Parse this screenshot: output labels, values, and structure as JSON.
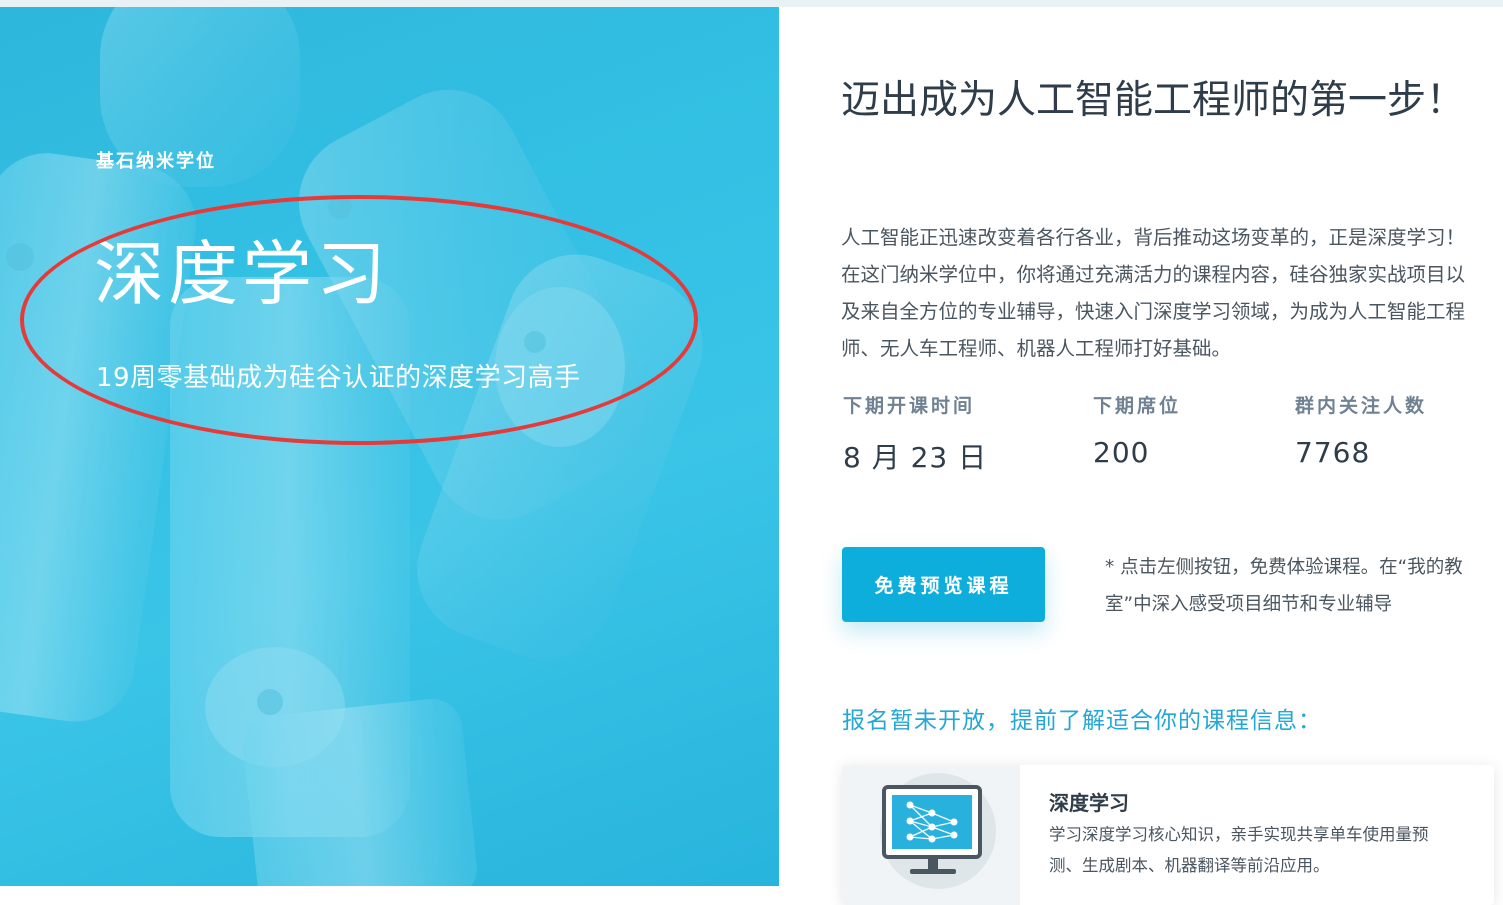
{
  "hero": {
    "eyebrow": "基石纳米学位",
    "title": "深度学习",
    "subtitle": "19周零基础成为硅谷认证的深度学习高手"
  },
  "colors": {
    "hero_bg": "#35c3e6",
    "accent": "#0eaedc",
    "annotation": "#e53a3a",
    "heading_text": "#2e3d49",
    "link_text": "#25a7d6"
  },
  "panel": {
    "headline": "迈出成为人工智能工程师的第一步！",
    "description": "人工智能正迅速改变着各行各业，背后推动这场变革的，正是深度学习！在这门纳米学位中，你将通过充满活力的课程内容，硅谷独家实战项目以及来自全方位的专业辅导，快速入门深度学习领域，为成为人工智能工程师、无人车工程师、机器人工程师打好基础。",
    "stats": [
      {
        "label": "下期开课时间",
        "value": "8 月 23 日"
      },
      {
        "label": "下期席位",
        "value": "200"
      },
      {
        "label": "群内关注人数",
        "value": "7768"
      }
    ],
    "cta_label": "免费预览课程",
    "cta_note": "* 点击左侧按钮，免费体验课程。在“我的教室”中深入感受项目细节和专业辅导",
    "enroll_text": "报名暂未开放，提前了解适合你的课程信息：",
    "course_card": {
      "title": "深度学习",
      "description": "学习深度学习核心知识，亲手实现共享单车使用量预测、生成剧本、机器翻译等前沿应用。",
      "icon": "neural-network-monitor-icon"
    }
  }
}
